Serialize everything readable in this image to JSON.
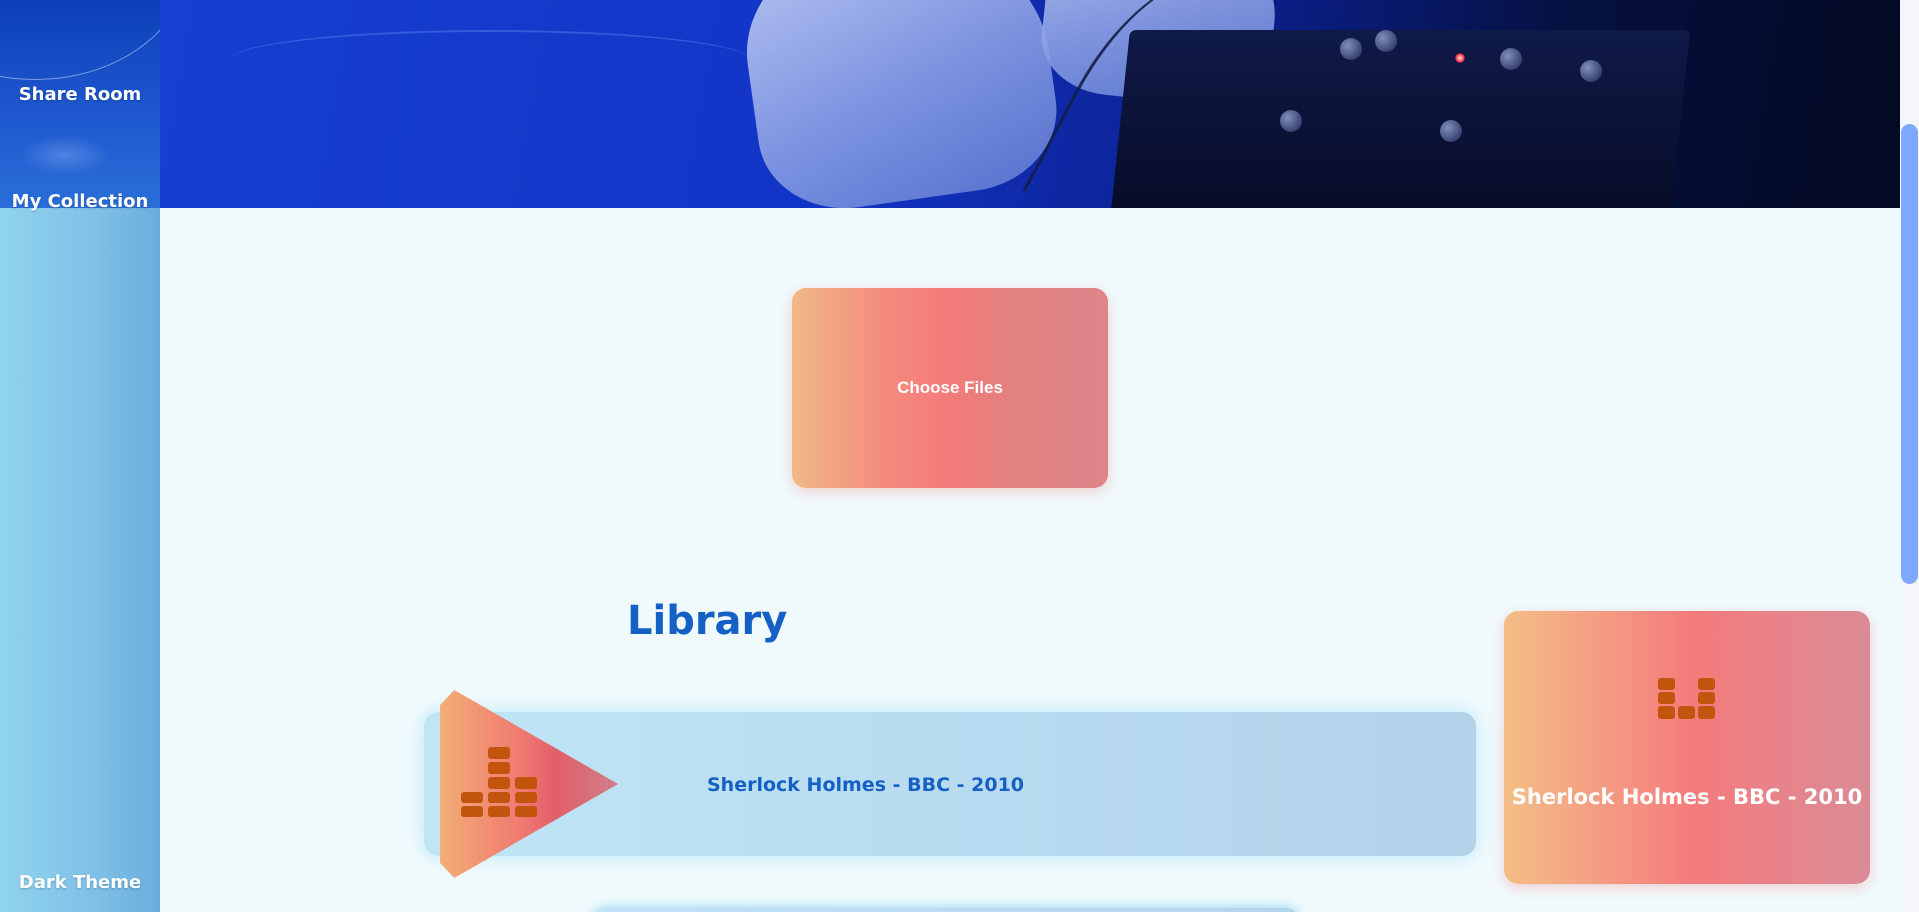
{
  "sidebar": {
    "share_room": "Share Room",
    "my_collection": "My Collection",
    "dark_theme": "Dark Theme"
  },
  "upload": {
    "choose_files_label": "Choose Files"
  },
  "library": {
    "title": "Library",
    "tracks": [
      {
        "title": "Sherlock Holmes - BBC - 2010"
      }
    ]
  },
  "now_playing": {
    "title": "Sherlock Holmes - BBC - 2010",
    "icon": "equalizer-icon"
  },
  "colors": {
    "accent_blue": "#1560c4",
    "hero_blue": "#1234c6",
    "gradient_orange": "#f2ae76",
    "gradient_coral": "#f37a7a",
    "equalizer_orange": "#c2540e",
    "scroll_thumb": "#7fa8ff"
  }
}
